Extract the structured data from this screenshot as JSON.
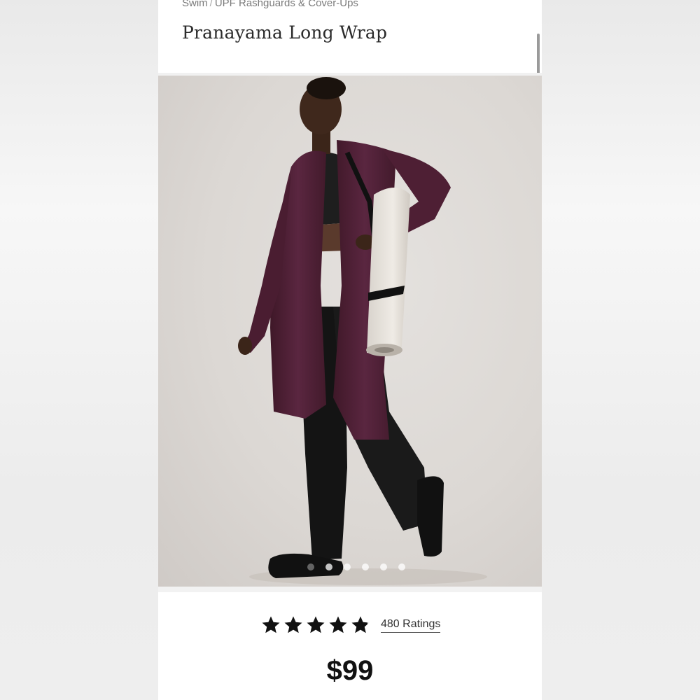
{
  "breadcrumb": {
    "items": [
      "Swim",
      "UPF Rashguards & Cover-Ups"
    ],
    "separator": "/"
  },
  "product": {
    "title": "Pranayama Long Wrap",
    "rating_value": 4.8,
    "rating_max": 5,
    "ratings_label": "480 Ratings",
    "price": "$99"
  },
  "gallery": {
    "image_count": 6,
    "active_index": 0
  },
  "colors": {
    "wrap": "#4e1f33",
    "background": "#dcd8d4",
    "price": "#111111"
  }
}
